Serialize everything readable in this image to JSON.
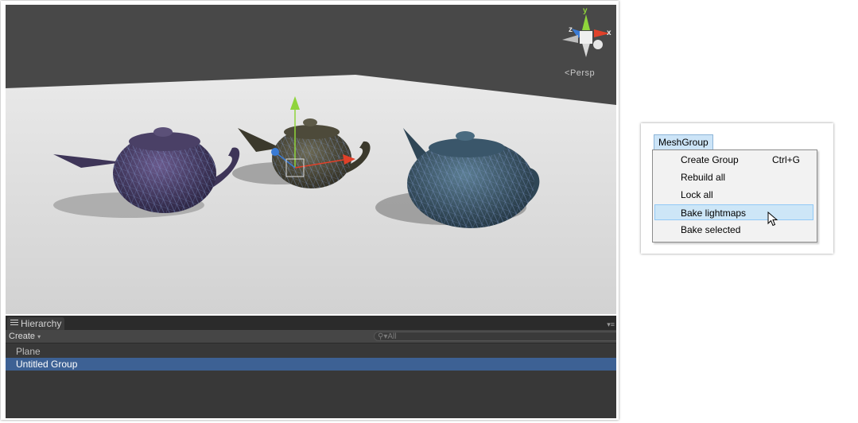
{
  "scene_view": {
    "camera_mode": "Persp",
    "gizmo_axes": {
      "y": "y",
      "x": "x",
      "z": "z"
    }
  },
  "hierarchy": {
    "tab_label": "Hierarchy",
    "create_label": "Create",
    "search_placeholder": "All",
    "items": [
      {
        "label": "Plane",
        "selected": false
      },
      {
        "label": "Untitled Group",
        "selected": true
      }
    ]
  },
  "menu": {
    "title": "MeshGroup",
    "items": [
      {
        "label": "Create Group",
        "shortcut": "Ctrl+G"
      },
      {
        "label": "Rebuild all",
        "shortcut": ""
      },
      {
        "label": "Lock all",
        "shortcut": ""
      },
      {
        "label": "Bake lightmaps",
        "shortcut": "",
        "highlighted": true
      },
      {
        "label": "Bake selected",
        "shortcut": ""
      }
    ]
  },
  "colors": {
    "selection": "#3d6194",
    "menu_highlight": "#cde6f7",
    "gizmo_x": "#e0412a",
    "gizmo_y": "#8fd43b",
    "gizmo_z": "#3a7bd5"
  }
}
